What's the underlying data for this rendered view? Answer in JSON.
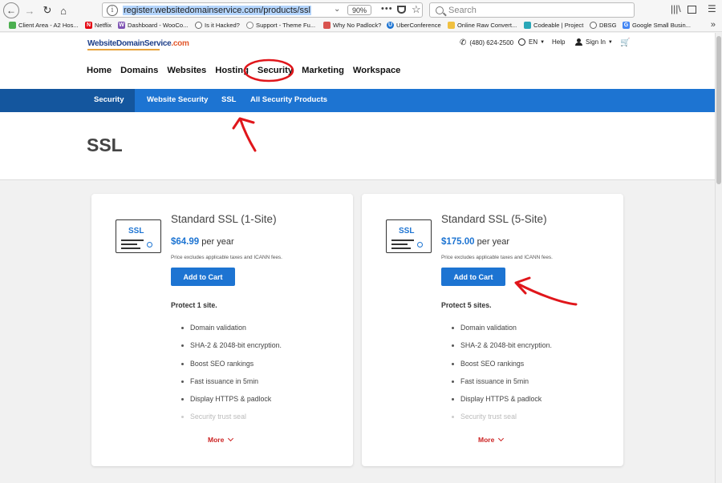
{
  "browser": {
    "url": "register.websitedomainservice.com/products/ssl",
    "zoom": "90%",
    "search_placeholder": "Search",
    "bookmarks": [
      {
        "label": "Client Area - A2 Hos...",
        "color": "#4caf50"
      },
      {
        "label": "Netflix",
        "color": "#e50914"
      },
      {
        "label": "Dashboard - WooCo...",
        "color": "#7f54b3"
      },
      {
        "label": "Is it Hacked?",
        "color": "#666666"
      },
      {
        "label": "Support - Theme Fu...",
        "color": "#888888"
      },
      {
        "label": "Why No Padlock?",
        "color": "#d9534f"
      },
      {
        "label": "UberConference",
        "color": "#1d74d2"
      },
      {
        "label": "Online Raw Convert...",
        "color": "#f0c040"
      },
      {
        "label": "Codeable | Project",
        "color": "#2aa7b8"
      },
      {
        "label": "DBSG",
        "color": "#666666"
      },
      {
        "label": "Google Small Busin...",
        "color": "#4285f4"
      }
    ]
  },
  "header": {
    "logo_main": "WebsiteDomainService",
    "logo_accent": ".com",
    "phone": "(480) 624-2500",
    "language": "EN",
    "help": "Help",
    "sign_in": "Sign In"
  },
  "main_nav": [
    "Home",
    "Domains",
    "Websites",
    "Hosting",
    "Security",
    "Marketing",
    "Workspace"
  ],
  "sub_nav": {
    "section": "Security",
    "items": [
      "Website Security",
      "SSL",
      "All Security Products"
    ]
  },
  "page_title": "SSL",
  "products": [
    {
      "icon_label": "SSL",
      "title": "Standard SSL (1-Site)",
      "price": "$64.99",
      "period": "per year",
      "fine_print": "Price excludes applicable taxes and ICANN fees.",
      "cta": "Add to Cart",
      "protect": "Protect 1 site.",
      "features": [
        "Domain validation",
        "SHA-2 & 2048-bit encryption.",
        "Boost SEO rankings",
        "Fast issuance in 5min",
        "Display HTTPS & padlock",
        "Security trust seal"
      ],
      "more": "More"
    },
    {
      "icon_label": "SSL",
      "title": "Standard SSL (5-Site)",
      "price": "$175.00",
      "period": "per year",
      "fine_print": "Price excludes applicable taxes and ICANN fees.",
      "cta": "Add to Cart",
      "protect": "Protect 5 sites.",
      "features": [
        "Domain validation",
        "SHA-2 & 2048-bit encryption.",
        "Boost SEO rankings",
        "Fast issuance in 5min",
        "Display HTTPS & padlock",
        "Security trust seal"
      ],
      "more": "More"
    }
  ],
  "colors": {
    "brand_blue": "#1d74d2",
    "subnav_dark": "#14569e",
    "annotation_red": "#e0161b"
  }
}
